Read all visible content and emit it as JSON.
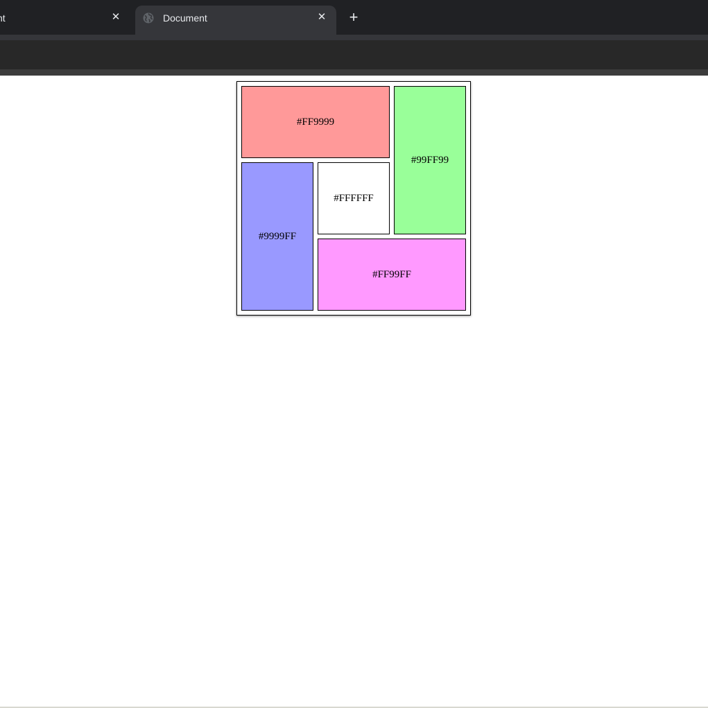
{
  "browser": {
    "tabs": [
      {
        "label": "nt",
        "active": false,
        "close": "✕"
      },
      {
        "label": "Document",
        "active": true,
        "close": "✕",
        "icon": "globe-icon"
      }
    ],
    "new_tab": "+"
  },
  "page": {
    "cells": [
      {
        "name": "red",
        "label": "#FF9999",
        "color": "#FF9999"
      },
      {
        "name": "green",
        "label": "#99FF99",
        "color": "#99FF99"
      },
      {
        "name": "blue",
        "label": "#9999FF",
        "color": "#9999FF"
      },
      {
        "name": "white",
        "label": "#FFFFFF",
        "color": "#FFFFFF"
      },
      {
        "name": "pink",
        "label": "#FF99FF",
        "color": "#FF99FF"
      }
    ]
  }
}
